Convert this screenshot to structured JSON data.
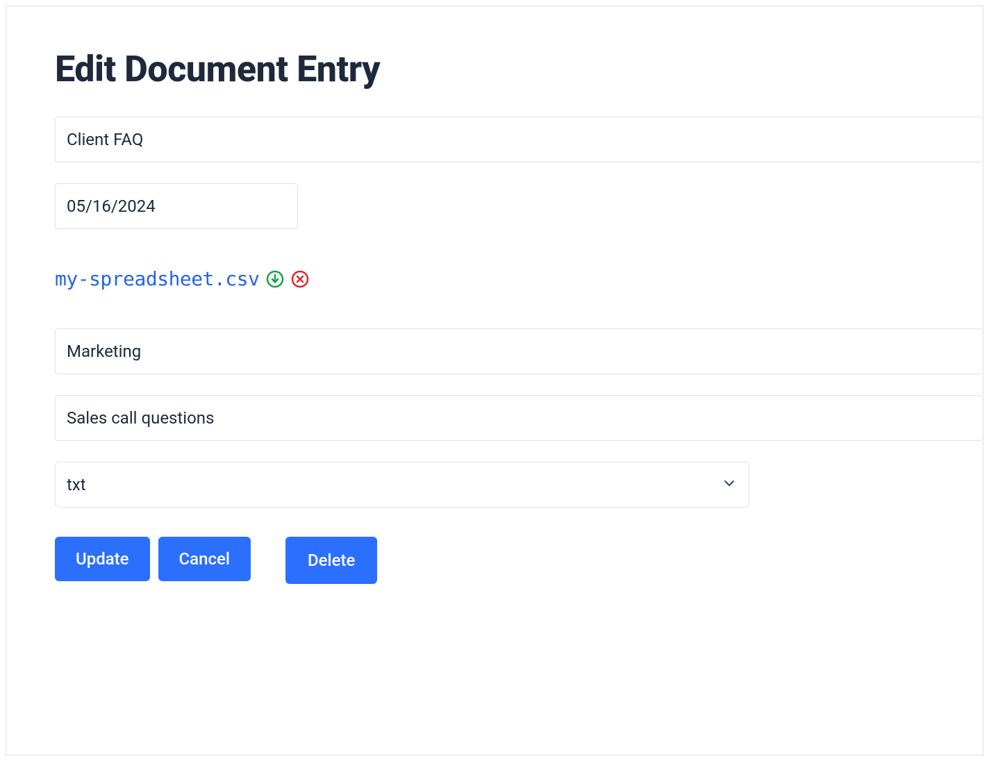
{
  "title": "Edit Document Entry",
  "form": {
    "name": "Client FAQ",
    "date": "05/16/2024",
    "file_name": "my-spreadsheet.csv",
    "category": "Marketing",
    "description": "Sales call questions",
    "format": "txt"
  },
  "buttons": {
    "update": "Update",
    "cancel": "Cancel",
    "delete": "Delete"
  },
  "icons": {
    "download": "download-circle-icon",
    "remove": "close-circle-icon",
    "chevron": "chevron-down-icon"
  }
}
